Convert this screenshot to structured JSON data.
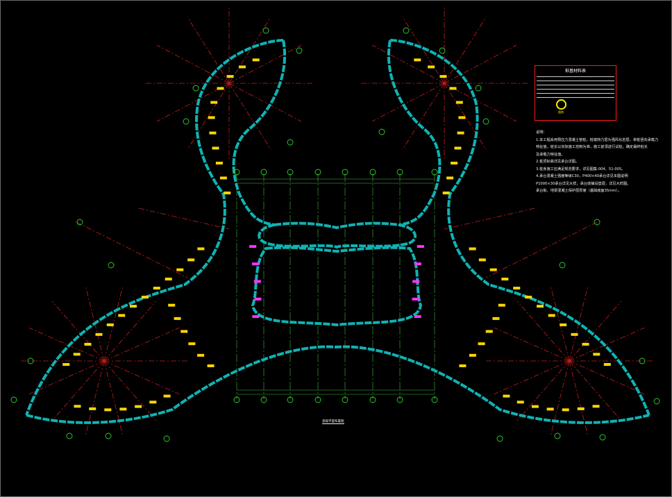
{
  "drawing": {
    "colors": {
      "background": "#000000",
      "wall": "#0fb3b3",
      "axis": "#c81e1e",
      "grid_line": "#3fbf3f",
      "grid_bubble": "#2fd12f",
      "pile": "#ffd700",
      "pile_special": "#ff33ff",
      "border_red": "#ff1a1a"
    },
    "plan_title": "基础平面布置图",
    "legend": {
      "title": "桩基材料表",
      "symbol_label": "图例"
    },
    "notes": {
      "heading": "说明：",
      "lines": [
        "1.本工程采用预应力混凝土管桩，桩端持力层为强风化岩层，单桩竖向承载力",
        "特征值，桩长以实际施工控制为准，施工前须进行试桩，确定最终桩长",
        "及承载力特征值。",
        "2.桩顶标高详见承台详图。",
        "3.桩身施工应满足规范要求，详见图集-004、51-005。",
        "4.承台混凝土强度等级C30，P400×40承台详见本图说明",
        "P1000×30承台详见大样，承台底铺设垫层，详见大样图。",
        "承台板、地梁混凝土保护层厚度（基础底面35mm）。"
      ]
    }
  }
}
